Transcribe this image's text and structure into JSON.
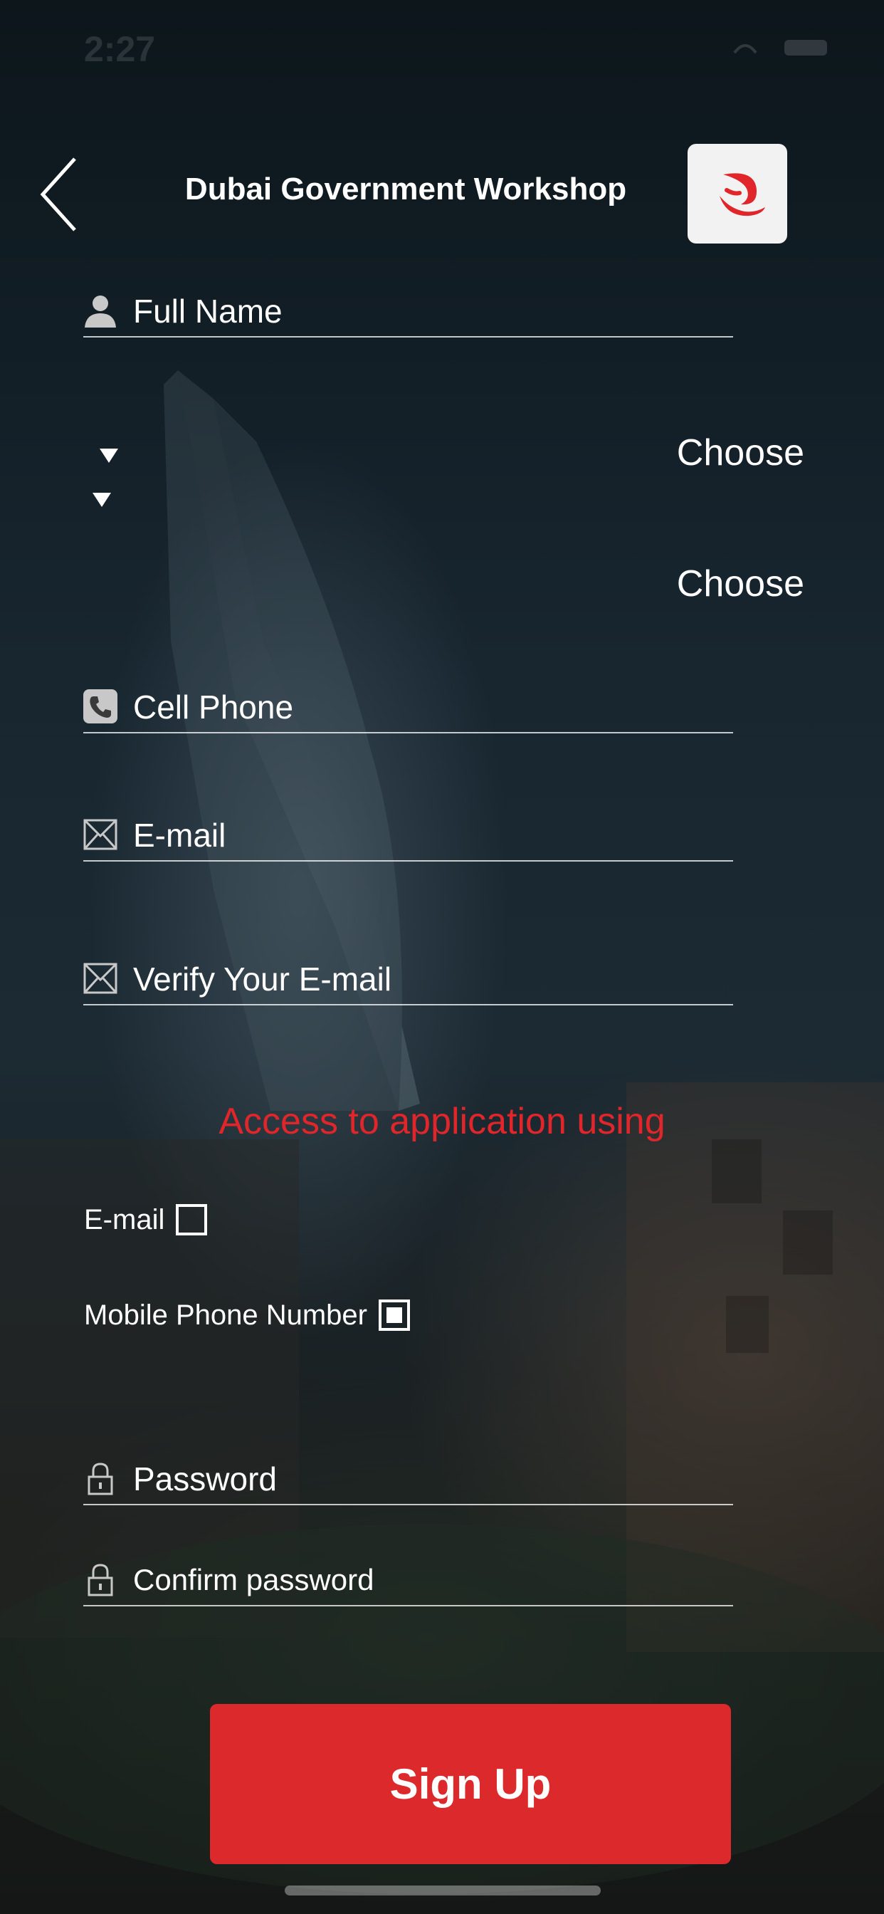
{
  "status_bar": {
    "time": "2:27"
  },
  "header": {
    "title": "Dubai Government Workshop",
    "logo_color": "#e0262a"
  },
  "form": {
    "full_name": {
      "placeholder": "Full Name",
      "icon": "person-icon"
    },
    "select_1": {
      "value": "Choose"
    },
    "select_2": {
      "value": "Choose"
    },
    "cell_phone": {
      "placeholder": "Cell Phone",
      "icon": "phone-icon"
    },
    "email": {
      "placeholder": "E-mail",
      "icon": "envelope-icon"
    },
    "verify_email": {
      "placeholder": "Verify Your E-mail",
      "icon": "envelope-icon"
    },
    "password": {
      "placeholder": "Password",
      "icon": "lock-icon"
    },
    "confirm_password": {
      "placeholder": "Confirm password",
      "icon": "lock-icon"
    }
  },
  "access": {
    "title": "Access to application using",
    "options": [
      {
        "label": "E-mail",
        "checked": false
      },
      {
        "label": "Mobile Phone Number",
        "checked": true
      }
    ]
  },
  "signup_label": "Sign Up",
  "colors": {
    "accent": "#dc2a2c",
    "text": "#ffffff"
  }
}
